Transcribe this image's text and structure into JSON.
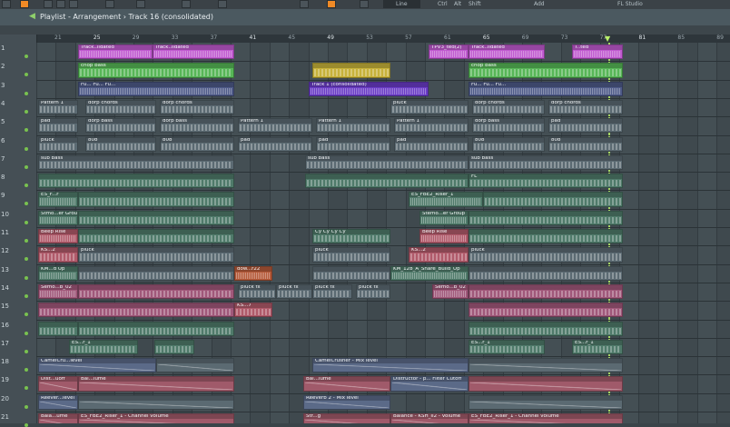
{
  "toolbar": {
    "line_mode": "Line",
    "buttons": [
      "Ctrl",
      "Alt",
      "Shift",
      "Add"
    ],
    "brand": "FL Studio"
  },
  "titlebar": {
    "title": "Playlist - Arrangement",
    "separator": "›",
    "current": "Track 16 (consolidated)"
  },
  "ruler": [
    {
      "n": "21"
    },
    {
      "n": "25",
      "bold": true
    },
    {
      "n": "29"
    },
    {
      "n": "33"
    },
    {
      "n": "37"
    },
    {
      "n": "41",
      "bold": true
    },
    {
      "n": "45"
    },
    {
      "n": "49",
      "bold": true
    },
    {
      "n": "53"
    },
    {
      "n": "57"
    },
    {
      "n": "61"
    },
    {
      "n": "65",
      "bold": true
    },
    {
      "n": "69"
    },
    {
      "n": "73"
    },
    {
      "n": "77"
    },
    {
      "n": "81",
      "bold": true
    },
    {
      "n": "85"
    },
    {
      "n": "89"
    }
  ],
  "tracks": [
    "1",
    "2",
    "3",
    "4",
    "5",
    "6",
    "7",
    "8",
    "9",
    "10",
    "11",
    "12",
    "13",
    "14",
    "15",
    "16",
    "17",
    "18",
    "19",
    "20",
    "21"
  ],
  "clips": [
    {
      "t": 0,
      "a": 86,
      "b": 168,
      "label": "Track..lidated",
      "c": "#c05ad0",
      "k": "wave"
    },
    {
      "t": 0,
      "a": 168,
      "b": 258,
      "label": "Track..lidated",
      "c": "#c05ad0",
      "k": "wave"
    },
    {
      "t": 0,
      "a": 472,
      "b": 516,
      "label": "TPV3_ted(2)",
      "c": "#c05ad0",
      "k": "wave"
    },
    {
      "t": 0,
      "a": 516,
      "b": 600,
      "label": "Track..lidated",
      "c": "#c05ad0",
      "k": "wave"
    },
    {
      "t": 0,
      "a": 630,
      "b": 686,
      "label": "T..ted",
      "c": "#c05ad0",
      "k": "wave"
    },
    {
      "t": 1,
      "a": 86,
      "b": 258,
      "label": "chop bass",
      "c": "#57b657",
      "k": "bars"
    },
    {
      "t": 1,
      "a": 344,
      "b": 430,
      "label": "",
      "c": "#c7b23a",
      "k": "bars"
    },
    {
      "t": 1,
      "a": 516,
      "b": 686,
      "label": "chop bass",
      "c": "#57b657",
      "k": "bars"
    },
    {
      "t": 2,
      "a": 86,
      "b": 258,
      "label": "Fu... Fu... Fu...",
      "c": "#4e5a88",
      "k": "wave"
    },
    {
      "t": 2,
      "a": 340,
      "b": 472,
      "label": "Track 1 (consolidated)",
      "c": "#6a3cc6",
      "k": "wave"
    },
    {
      "t": 2,
      "a": 516,
      "b": 686,
      "label": "Fu... Fu... Fu...",
      "c": "#4e5a88",
      "k": "wave"
    },
    {
      "t": 3,
      "a": 42,
      "b": 86,
      "label": "Pattern 1",
      "c": "#5b6a72",
      "k": "bars"
    },
    {
      "t": 3,
      "a": 94,
      "b": 172,
      "label": "dorp chords",
      "c": "#5b6a72",
      "k": "bars"
    },
    {
      "t": 3,
      "a": 176,
      "b": 258,
      "label": "dorp chords",
      "c": "#5b6a72",
      "k": "bars"
    },
    {
      "t": 3,
      "a": 430,
      "b": 516,
      "label": "pluck",
      "c": "#5b6a72",
      "k": "bars"
    },
    {
      "t": 3,
      "a": 520,
      "b": 600,
      "label": "dorp chords",
      "c": "#5b6a72",
      "k": "bars"
    },
    {
      "t": 3,
      "a": 604,
      "b": 686,
      "label": "dorp chords",
      "c": "#5b6a72",
      "k": "bars"
    },
    {
      "t": 4,
      "a": 42,
      "b": 86,
      "label": "pad",
      "c": "#5b6a72",
      "k": "bars"
    },
    {
      "t": 4,
      "a": 94,
      "b": 172,
      "label": "dorp bass",
      "c": "#5b6a72",
      "k": "bars"
    },
    {
      "t": 4,
      "a": 176,
      "b": 258,
      "label": "dorp bass",
      "c": "#5b6a72",
      "k": "bars"
    },
    {
      "t": 4,
      "a": 262,
      "b": 344,
      "label": "Pattern 1",
      "c": "#5b6a72",
      "k": "bars"
    },
    {
      "t": 4,
      "a": 348,
      "b": 430,
      "label": "Pattern 1",
      "c": "#5b6a72",
      "k": "bars"
    },
    {
      "t": 4,
      "a": 434,
      "b": 516,
      "label": "Pattern 1",
      "c": "#5b6a72",
      "k": "bars"
    },
    {
      "t": 4,
      "a": 520,
      "b": 600,
      "label": "dorp bass",
      "c": "#5b6a72",
      "k": "bars"
    },
    {
      "t": 4,
      "a": 604,
      "b": 686,
      "label": "pad",
      "c": "#5b6a72",
      "k": "bars"
    },
    {
      "t": 5,
      "a": 42,
      "b": 86,
      "label": "pluck",
      "c": "#5b6a72",
      "k": "bars"
    },
    {
      "t": 5,
      "a": 94,
      "b": 172,
      "label": "808",
      "c": "#5b6a72",
      "k": "bars"
    },
    {
      "t": 5,
      "a": 176,
      "b": 258,
      "label": "808",
      "c": "#5b6a72",
      "k": "bars"
    },
    {
      "t": 5,
      "a": 262,
      "b": 344,
      "label": "pad",
      "c": "#5b6a72",
      "k": "bars"
    },
    {
      "t": 5,
      "a": 348,
      "b": 430,
      "label": "pad",
      "c": "#5b6a72",
      "k": "bars"
    },
    {
      "t": 5,
      "a": 434,
      "b": 516,
      "label": "pad",
      "c": "#5b6a72",
      "k": "bars"
    },
    {
      "t": 5,
      "a": 520,
      "b": 600,
      "label": "808",
      "c": "#5b6a72",
      "k": "bars"
    },
    {
      "t": 5,
      "a": 604,
      "b": 686,
      "label": "808",
      "c": "#5b6a72",
      "k": "bars"
    },
    {
      "t": 6,
      "a": 42,
      "b": 258,
      "label": "sub bass",
      "c": "#5b6a72",
      "k": "bars"
    },
    {
      "t": 6,
      "a": 336,
      "b": 516,
      "label": "sub bass",
      "c": "#5b6a72",
      "k": "bars"
    },
    {
      "t": 6,
      "a": 516,
      "b": 686,
      "label": "sub bass",
      "c": "#5b6a72",
      "k": "bars"
    },
    {
      "t": 7,
      "a": 42,
      "b": 258,
      "label": "",
      "c": "#4f7a6a",
      "k": "bars"
    },
    {
      "t": 7,
      "a": 336,
      "b": 516,
      "label": "",
      "c": "#4f7a6a",
      "k": "bars"
    },
    {
      "t": 7,
      "a": 516,
      "b": 686,
      "label": "FL",
      "c": "#4f7a6a",
      "k": "bars"
    },
    {
      "t": 8,
      "a": 42,
      "b": 86,
      "label": "ES_F...r",
      "c": "#4f7a6a",
      "k": "wave"
    },
    {
      "t": 8,
      "a": 86,
      "b": 258,
      "label": "",
      "c": "#4f7a6a",
      "k": "bars"
    },
    {
      "t": 8,
      "a": 450,
      "b": 532,
      "label": "ES_FBE2_Riser_1",
      "c": "#4f7a6a",
      "k": "wave"
    },
    {
      "t": 8,
      "a": 532,
      "b": 686,
      "label": "",
      "c": "#4f7a6a",
      "k": "bars"
    },
    {
      "t": 9,
      "a": 42,
      "b": 86,
      "label": "Stmo...er Group",
      "c": "#4f7a6a",
      "k": "wave"
    },
    {
      "t": 9,
      "a": 86,
      "b": 258,
      "label": "",
      "c": "#4f7a6a",
      "k": "bars"
    },
    {
      "t": 9,
      "a": 462,
      "b": 516,
      "label": "Stemo...er Group",
      "c": "#4f7a6a",
      "k": "wave"
    },
    {
      "t": 9,
      "a": 516,
      "b": 686,
      "label": "",
      "c": "#4f7a6a",
      "k": "bars"
    },
    {
      "t": 10,
      "a": 42,
      "b": 86,
      "label": "Beep Rise",
      "c": "#b05a6a",
      "k": "wave"
    },
    {
      "t": 10,
      "a": 86,
      "b": 258,
      "label": "",
      "c": "#4f7a6a",
      "k": "bars"
    },
    {
      "t": 10,
      "a": 344,
      "b": 430,
      "label": "Cy Cy Cy Cy",
      "c": "#4f7a6a",
      "k": "bars"
    },
    {
      "t": 10,
      "a": 462,
      "b": 516,
      "label": "Beep Rise",
      "c": "#b05a6a",
      "k": "wave"
    },
    {
      "t": 10,
      "a": 516,
      "b": 686,
      "label": "",
      "c": "#4f7a6a",
      "k": "bars"
    },
    {
      "t": 11,
      "a": 42,
      "b": 86,
      "label": "KS...2",
      "c": "#b05a6a",
      "k": "bars"
    },
    {
      "t": 11,
      "a": 86,
      "b": 258,
      "label": "pluck",
      "c": "#5b6a72",
      "k": "bars"
    },
    {
      "t": 11,
      "a": 344,
      "b": 430,
      "label": "pluck",
      "c": "#5b6a72",
      "k": "bars"
    },
    {
      "t": 11,
      "a": 450,
      "b": 516,
      "label": "KS...2",
      "c": "#b05a6a",
      "k": "bars"
    },
    {
      "t": 11,
      "a": 516,
      "b": 686,
      "label": "pluck",
      "c": "#5b6a72",
      "k": "bars"
    },
    {
      "t": 12,
      "a": 42,
      "b": 86,
      "label": "KM...d Up",
      "c": "#4f7a6a",
      "k": "wave"
    },
    {
      "t": 12,
      "a": 86,
      "b": 258,
      "label": "",
      "c": "#5b6a72",
      "k": "bars"
    },
    {
      "t": 12,
      "a": 258,
      "b": 300,
      "label": "dow...r22",
      "c": "#b55a3a",
      "k": "wave"
    },
    {
      "t": 12,
      "a": 344,
      "b": 430,
      "label": "",
      "c": "#5b6a72",
      "k": "bars"
    },
    {
      "t": 12,
      "a": 430,
      "b": 516,
      "label": "KM_128_A_Snare_Build_Up",
      "c": "#4f7a6a",
      "k": "wave"
    },
    {
      "t": 12,
      "a": 516,
      "b": 686,
      "label": "",
      "c": "#5b6a72",
      "k": "bars"
    },
    {
      "t": 13,
      "a": 42,
      "b": 86,
      "label": "Semo...b_02",
      "c": "#a0587a",
      "k": "wave"
    },
    {
      "t": 13,
      "a": 86,
      "b": 258,
      "label": "",
      "c": "#a0587a",
      "k": "bars"
    },
    {
      "t": 13,
      "a": 262,
      "b": 304,
      "label": "pluck fx",
      "c": "#5b6a72",
      "k": "bars"
    },
    {
      "t": 13,
      "a": 304,
      "b": 344,
      "label": "pluck fx",
      "c": "#5b6a72",
      "k": "bars"
    },
    {
      "t": 13,
      "a": 344,
      "b": 388,
      "label": "pluck fx",
      "c": "#5b6a72",
      "k": "bars"
    },
    {
      "t": 13,
      "a": 392,
      "b": 430,
      "label": "pluck fx",
      "c": "#5b6a72",
      "k": "bars"
    },
    {
      "t": 13,
      "a": 476,
      "b": 516,
      "label": "Semo...b_02",
      "c": "#a0587a",
      "k": "wave"
    },
    {
      "t": 13,
      "a": 516,
      "b": 686,
      "label": "",
      "c": "#a0587a",
      "k": "bars"
    },
    {
      "t": 14,
      "a": 42,
      "b": 258,
      "label": "",
      "c": "#a0587a",
      "k": "bars"
    },
    {
      "t": 14,
      "a": 258,
      "b": 300,
      "label": "KS...7",
      "c": "#b05a6a",
      "k": "bars"
    },
    {
      "t": 14,
      "a": 516,
      "b": 686,
      "label": "",
      "c": "#a0587a",
      "k": "bars"
    },
    {
      "t": 15,
      "a": 42,
      "b": 86,
      "label": "",
      "c": "#4f7a6a",
      "k": "bars"
    },
    {
      "t": 15,
      "a": 86,
      "b": 258,
      "label": "",
      "c": "#4f7a6a",
      "k": "bars"
    },
    {
      "t": 15,
      "a": 516,
      "b": 686,
      "label": "",
      "c": "#4f7a6a",
      "k": "bars"
    },
    {
      "t": 16,
      "a": 76,
      "b": 152,
      "label": "ES...r_1",
      "c": "#4f7a6a",
      "k": "bars"
    },
    {
      "t": 16,
      "a": 170,
      "b": 214,
      "label": "",
      "c": "#4f7a6a",
      "k": "bars"
    },
    {
      "t": 16,
      "a": 516,
      "b": 600,
      "label": "ES...r_1",
      "c": "#4f7a6a",
      "k": "bars"
    },
    {
      "t": 16,
      "a": 630,
      "b": 686,
      "label": "ES...r_1",
      "c": "#4f7a6a",
      "k": "bars"
    },
    {
      "t": 17,
      "a": 42,
      "b": 172,
      "label": "CamelCru...level",
      "c": "#5b6a88",
      "k": "auto"
    },
    {
      "t": 17,
      "a": 172,
      "b": 258,
      "label": "",
      "c": "#5b6a72",
      "k": "auto"
    },
    {
      "t": 17,
      "a": 344,
      "b": 516,
      "label": "CamelCrusher - Mix level",
      "c": "#5b6a88",
      "k": "auto"
    },
    {
      "t": 17,
      "a": 516,
      "b": 686,
      "label": "",
      "c": "#5b6a72",
      "k": "auto"
    },
    {
      "t": 18,
      "a": 42,
      "b": 86,
      "label": "Dist...uoff",
      "c": "#a05a6a",
      "k": "auto"
    },
    {
      "t": 18,
      "a": 86,
      "b": 258,
      "label": "Bal...lume",
      "c": "#a05a6a",
      "k": "auto"
    },
    {
      "t": 18,
      "a": 334,
      "b": 430,
      "label": "Bal...lume",
      "c": "#a05a6a",
      "k": "auto"
    },
    {
      "t": 18,
      "a": 430,
      "b": 516,
      "label": "Distructor - p... Filter Cutoff",
      "c": "#5b6a88",
      "k": "auto"
    },
    {
      "t": 18,
      "a": 516,
      "b": 686,
      "label": "",
      "c": "#a05a6a",
      "k": "auto"
    },
    {
      "t": 19,
      "a": 42,
      "b": 86,
      "label": "Reever...level",
      "c": "#5b6a88",
      "k": "auto"
    },
    {
      "t": 19,
      "a": 86,
      "b": 258,
      "label": "",
      "c": "#5b6a72",
      "k": "auto"
    },
    {
      "t": 19,
      "a": 334,
      "b": 430,
      "label": "Reeverb 2 - Mix level",
      "c": "#5b6a88",
      "k": "auto"
    },
    {
      "t": 19,
      "a": 516,
      "b": 686,
      "label": "",
      "c": "#5b6a72",
      "k": "auto"
    },
    {
      "t": 20,
      "a": 42,
      "b": 86,
      "label": "Bala...ume",
      "c": "#a05a6a",
      "k": "auto"
    },
    {
      "t": 20,
      "a": 86,
      "b": 258,
      "label": "ES_FBE2_Riser_1 - Channel volume",
      "c": "#a05a6a",
      "k": "auto"
    },
    {
      "t": 20,
      "a": 334,
      "b": 430,
      "label": "Str...g",
      "c": "#a05a6a",
      "k": "auto"
    },
    {
      "t": 20,
      "a": 430,
      "b": 516,
      "label": "Balance - KSH_II2 - Volume",
      "c": "#a05a6a",
      "k": "auto"
    },
    {
      "t": 20,
      "a": 516,
      "b": 686,
      "label": "ES_FBE2_Riser_1 - Channel volume",
      "c": "#a05a6a",
      "k": "auto"
    }
  ]
}
